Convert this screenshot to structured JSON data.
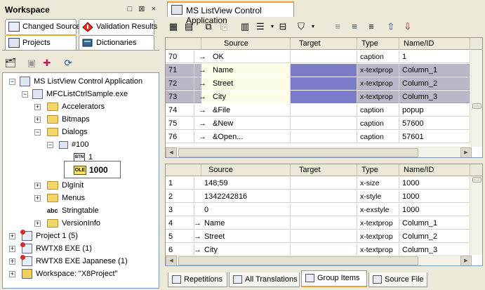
{
  "left": {
    "title": "Workspace",
    "window_ctrls": "□ ⊠ ×",
    "tabs": [
      {
        "label": "Changed Source",
        "icon": "changed-source-icon"
      },
      {
        "label": "Validation Results",
        "icon": "validation-icon"
      },
      {
        "label": "Projects",
        "icon": "projects-icon"
      },
      {
        "label": "Dictionaries",
        "icon": "dictionaries-icon"
      }
    ],
    "tree": [
      {
        "label": "MS ListView Control Application",
        "depth": 0
      },
      {
        "label": "MFCListCtrlSample.exe",
        "depth": 1
      },
      {
        "label": "Accelerators",
        "depth": 2
      },
      {
        "label": "Bitmaps",
        "depth": 2
      },
      {
        "label": "Dialogs",
        "depth": 2
      },
      {
        "label": "#100",
        "depth": 3
      },
      {
        "label": "1",
        "depth": 4,
        "badge": "BTN"
      },
      {
        "label": "1000",
        "depth": 4,
        "badge": "OLE",
        "selected": true
      },
      {
        "label": "DlgInit",
        "depth": 2
      },
      {
        "label": "Menus",
        "depth": 2
      },
      {
        "label": "Stringtable",
        "depth": 2,
        "badge": "abc"
      },
      {
        "label": "VersionInfo",
        "depth": 2
      },
      {
        "label": "Project 1 (5)",
        "depth": 0
      },
      {
        "label": "RWTX8 EXE (1)",
        "depth": 0
      },
      {
        "label": "RWTX8 EXE Japanese (1)",
        "depth": 0
      },
      {
        "label": "Workspace: \"X8Project\"",
        "depth": 0
      }
    ]
  },
  "doc_tab": "MS ListView Control Application",
  "columns": [
    "Source",
    "Target",
    "Type",
    "Name/ID"
  ],
  "grid1": {
    "rows": [
      {
        "num": "70",
        "arrow": "→",
        "source": "OK",
        "target": "",
        "type": "caption",
        "name": "1",
        "selected": false
      },
      {
        "num": "71",
        "arrow": "→",
        "source": "Name",
        "target": "",
        "type": "x-textprop",
        "name": "Column_1",
        "selected": true
      },
      {
        "num": "72",
        "arrow": "→",
        "source": "Street",
        "target": "",
        "type": "x-textprop",
        "name": "Column_2",
        "selected": true
      },
      {
        "num": "73",
        "arrow": "→",
        "source": "City",
        "target": "",
        "type": "x-textprop",
        "name": "Column_3",
        "selected": true
      },
      {
        "num": "74",
        "arrow": "→",
        "source": "&File",
        "target": "",
        "type": "caption",
        "name": "popup",
        "selected": false
      },
      {
        "num": "75",
        "arrow": "→",
        "source": "&New",
        "target": "",
        "type": "caption",
        "name": "57600",
        "selected": false
      },
      {
        "num": "76",
        "arrow": "→",
        "source": "&Open...",
        "target": "",
        "type": "caption",
        "name": "57601",
        "selected": false
      }
    ]
  },
  "grid2": {
    "rows": [
      {
        "num": "1",
        "arrow": "",
        "source": "148;59",
        "target": "",
        "type": "x-size",
        "name": "1000"
      },
      {
        "num": "2",
        "arrow": "",
        "source": "1342242816",
        "target": "",
        "type": "x-style",
        "name": "1000"
      },
      {
        "num": "3",
        "arrow": "",
        "source": "0",
        "target": "",
        "type": "x-exstyle",
        "name": "1000"
      },
      {
        "num": "4",
        "arrow": "→",
        "source": "Name",
        "target": "",
        "type": "x-textprop",
        "name": "Column_1"
      },
      {
        "num": "5",
        "arrow": "→",
        "source": "Street",
        "target": "",
        "type": "x-textprop",
        "name": "Column_2"
      },
      {
        "num": "6",
        "arrow": "→",
        "source": "City",
        "target": "",
        "type": "x-textprop",
        "name": "Column_3"
      }
    ]
  },
  "bottom_tabs": [
    "Repetitions",
    "All Translations",
    "Group Items",
    "Source File"
  ],
  "colors": {
    "accent": "#e6a82a",
    "selection": "#7b7bc8",
    "selected_row": "#b8b8c8",
    "tree_highlight": "#e03030"
  }
}
